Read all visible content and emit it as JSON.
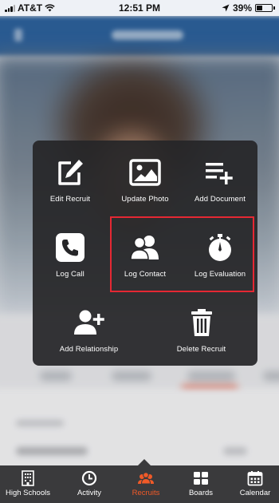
{
  "status_bar": {
    "carrier": "AT&T",
    "time": "12:51 PM",
    "battery": "39%",
    "battery_level": 0.39
  },
  "colors": {
    "accent": "#f05a28",
    "highlight": "#e52833",
    "menu_bg": "#262628",
    "tab_bar_bg": "#3a3a3c",
    "header_bg": "#2a5f9a"
  },
  "action_menu": {
    "items": [
      {
        "label": "Edit Recruit",
        "icon": "edit-icon"
      },
      {
        "label": "Update Photo",
        "icon": "photo-icon"
      },
      {
        "label": "Add Document",
        "icon": "add-document-icon"
      },
      {
        "label": "Log Call",
        "icon": "phone-icon"
      },
      {
        "label": "Log Contact",
        "icon": "contacts-icon"
      },
      {
        "label": "Log Evaluation",
        "icon": "stopwatch-icon"
      },
      {
        "label": "Add Relationship",
        "icon": "add-person-icon"
      },
      {
        "label": "Delete Recruit",
        "icon": "trash-icon"
      }
    ]
  },
  "tab_bar": {
    "active": "Recruits",
    "tabs": [
      {
        "label": "High Schools",
        "icon": "building-icon"
      },
      {
        "label": "Activity",
        "icon": "clock-icon"
      },
      {
        "label": "Recruits",
        "icon": "recruits-icon"
      },
      {
        "label": "Boards",
        "icon": "boards-icon"
      },
      {
        "label": "Calendar",
        "icon": "calendar-icon"
      }
    ]
  }
}
